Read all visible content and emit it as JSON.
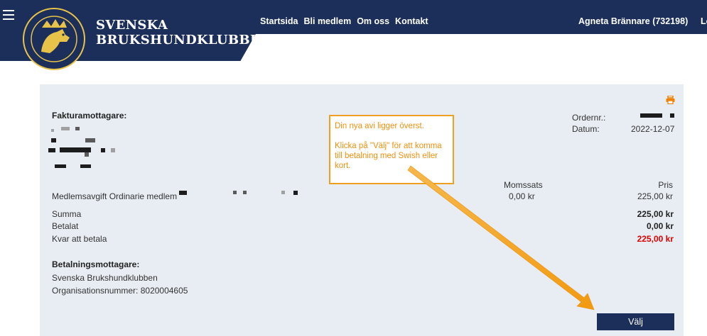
{
  "header": {
    "brand_line1": "SVENSKA",
    "brand_line2": "BRUKSHUNDKLUBBEN",
    "nav": [
      "Startsida",
      "Bli medlem",
      "Om oss",
      "Kontakt"
    ],
    "user": "Agneta Brännare (732198)",
    "logout": "Logg"
  },
  "invoice": {
    "recipient_heading": "Fakturamottagare:",
    "order_label": "Ordernr.:",
    "date_label": "Datum:",
    "date_value": "2022-12-07",
    "vat_header": "Momssats",
    "price_header": "Pris",
    "line_item_label": "Medlemsavgift Ordinarie medlem",
    "line_item_vat": "0,00 kr",
    "line_item_price": "225,00 kr",
    "sum_label": "Summa",
    "sum_value": "225,00 kr",
    "paid_label": "Betalat",
    "paid_value": "0,00 kr",
    "remaining_label": "Kvar att betala",
    "remaining_value": "225,00 kr",
    "payee_heading": "Betalningsmottagare:",
    "payee_name": "Svenska Brukshundklubben",
    "org_number": "Organisationsnummer: 8020004605",
    "choose_button": "Välj"
  },
  "callout": {
    "line1": "Din nya avi ligger överst.",
    "line2": "Klicka på \"Välj\" för att komma till betalning med Swish eller kort."
  },
  "colors": {
    "header_bg": "#1c2f5a",
    "panel_bg": "#e8edf3",
    "accent_orange": "#f0a020",
    "due_red": "#e00000"
  },
  "icons": [
    "menu-icon",
    "printer-icon",
    "arrow-annotation"
  ]
}
